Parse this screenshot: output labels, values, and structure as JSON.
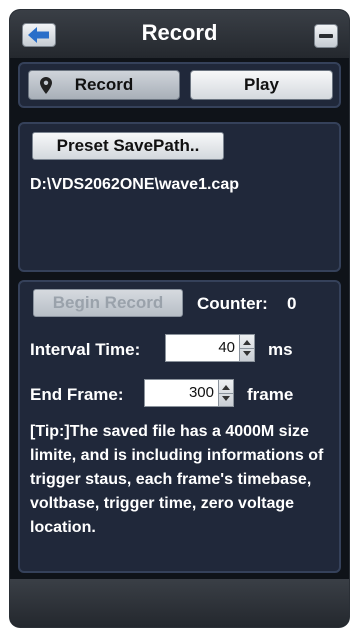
{
  "window": {
    "title": "Record"
  },
  "tabs": {
    "record_label": "Record",
    "play_label": "Play"
  },
  "save_path": {
    "button_label": "Preset SavePath..",
    "path": "D:\\VDS2062ONE\\wave1.cap"
  },
  "record": {
    "begin_label": "Begin Record",
    "counter_label": "Counter:",
    "counter_value": "0",
    "interval_label": "Interval Time:",
    "interval_value": "40",
    "interval_unit": "ms",
    "end_frame_label": "End Frame:",
    "end_frame_value": "300",
    "end_frame_unit": "frame",
    "tip": "[Tip:]The saved file has a 4000M size limite, and is including informations of trigger staus, each frame's timebase, voltbase, trigger time, zero voltage location."
  },
  "icons": {
    "back": "back-arrow-icon",
    "minimize": "minus-icon",
    "pin": "location-pin-icon"
  },
  "colors": {
    "window_bg": "#0f1319",
    "panel_bg": "#20283a",
    "back_arrow": "#2a6fc9"
  }
}
